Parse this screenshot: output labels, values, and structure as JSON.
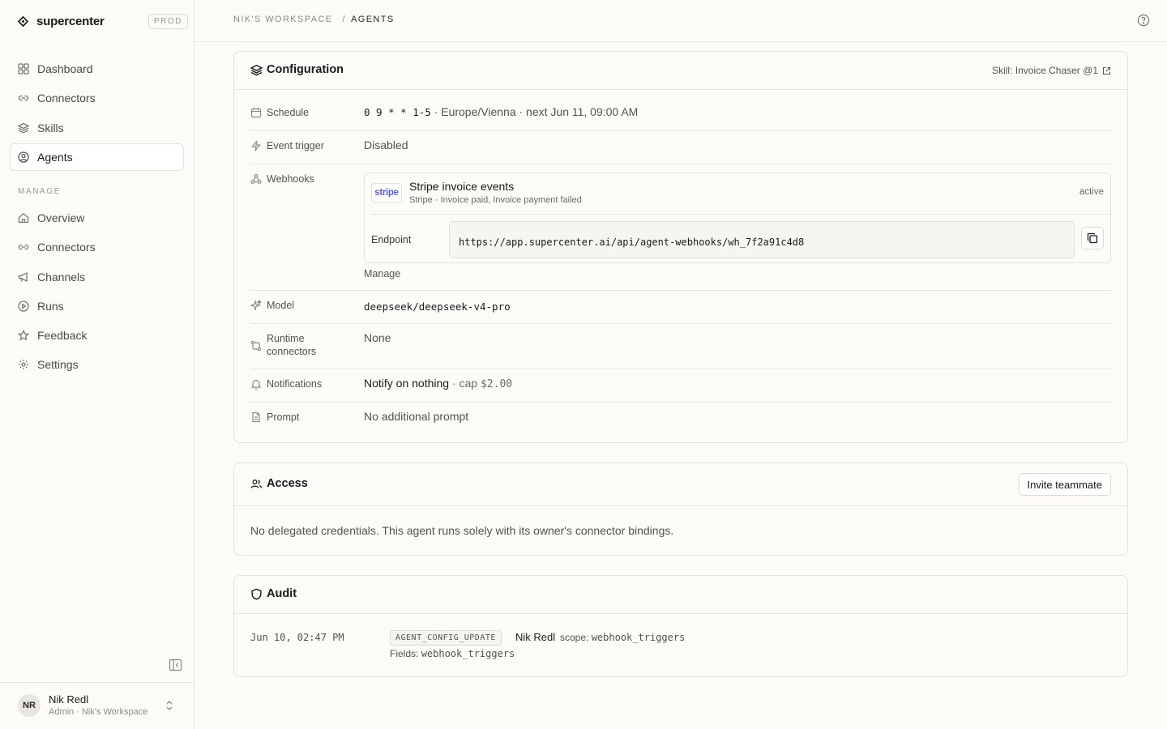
{
  "app": {
    "name": "supercenter",
    "env": "PROD"
  },
  "nav": {
    "main": [
      {
        "label": "Dashboard",
        "icon": "grid-icon"
      },
      {
        "label": "Connectors",
        "icon": "link-icon"
      },
      {
        "label": "Skills",
        "icon": "layers-icon"
      },
      {
        "label": "Agents",
        "icon": "user-circle-icon",
        "active": true
      }
    ],
    "section_label": "MANAGE",
    "manage": [
      {
        "label": "Overview",
        "icon": "home-icon"
      },
      {
        "label": "Connectors",
        "icon": "link-icon"
      },
      {
        "label": "Channels",
        "icon": "megaphone-icon"
      },
      {
        "label": "Runs",
        "icon": "play-circle-icon"
      },
      {
        "label": "Feedback",
        "icon": "star-icon"
      },
      {
        "label": "Settings",
        "icon": "gear-icon"
      }
    ]
  },
  "user": {
    "initials": "NR",
    "name": "Nik Redl",
    "subtitle": "Admin · Nik's Workspace"
  },
  "breadcrumb": {
    "workspace": "NIK'S WORKSPACE",
    "separator": "/",
    "current": "AGENTS"
  },
  "configuration": {
    "title": "Configuration",
    "skill_link": "Skill: Invoice Chaser @1",
    "rows": {
      "schedule": {
        "label": "Schedule",
        "cron": "0 9 * * 1-5",
        "detail": " · Europe/Vienna · next Jun 11, 09:00 AM"
      },
      "event_trigger": {
        "label": "Event trigger",
        "value": "Disabled"
      },
      "webhooks": {
        "label": "Webhooks",
        "logo": "stripe",
        "title": "Stripe invoice events",
        "subtitle": "Stripe · Invoice paid, Invoice payment failed",
        "status": "active",
        "endpoint_label": "Endpoint",
        "endpoint_url": "https://app.supercenter.ai/api/agent-webhooks/wh_7f2a91c4d8",
        "manage": "Manage"
      },
      "model": {
        "label": "Model",
        "value": "deepseek/deepseek-v4-pro"
      },
      "runtime_connectors": {
        "label_line1": "Runtime",
        "label_line2": "connectors",
        "value": "None"
      },
      "notifications": {
        "label": "Notifications",
        "value": "Notify on nothing",
        "cap_prefix": " · cap ",
        "cap": "$2.00"
      },
      "prompt": {
        "label": "Prompt",
        "value": "No additional prompt"
      }
    }
  },
  "access": {
    "title": "Access",
    "invite_button": "Invite teammate",
    "text": "No delegated credentials. This agent runs solely with its owner's connector bindings."
  },
  "audit": {
    "title": "Audit",
    "entries": [
      {
        "time": "Jun 10, 02:47 PM",
        "event": "AGENT_CONFIG_UPDATE",
        "user": "Nik Redl",
        "scope_label": "scope: ",
        "scope": "webhook_triggers",
        "fields_label": "Fields: ",
        "fields": "webhook_triggers"
      }
    ]
  }
}
